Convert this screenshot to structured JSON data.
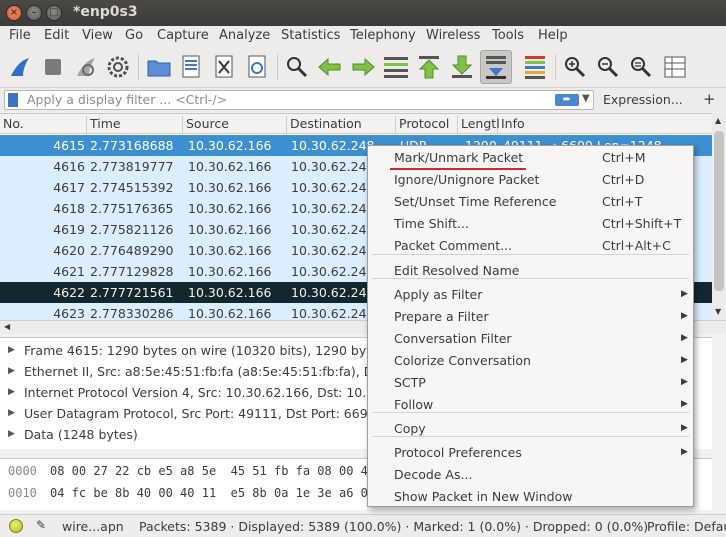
{
  "window": {
    "title": "*enp0s3"
  },
  "menubar": [
    "File",
    "Edit",
    "View",
    "Go",
    "Capture",
    "Analyze",
    "Statistics",
    "Telephony",
    "Wireless",
    "Tools",
    "Help"
  ],
  "toolbar_icons": [
    "shark-fin-start-icon",
    "stop-icon",
    "restart-icon",
    "options-gear-icon",
    "open-folder-icon",
    "save-file-icon",
    "close-file-icon",
    "reload-icon",
    "find-magnifier-icon",
    "go-back-icon",
    "go-forward-icon",
    "go-to-packet-icon",
    "first-packet-icon",
    "last-packet-icon",
    "autoscroll-icon",
    "colorize-icon",
    "zoom-in-icon",
    "zoom-out-icon",
    "zoom-normal-icon",
    "resize-columns-icon"
  ],
  "filter": {
    "placeholder": "Apply a display filter ... <Ctrl-/>",
    "expression_label": "Expression...",
    "plus": "+"
  },
  "columns": [
    "No.",
    "Time",
    "Source",
    "Destination",
    "Protocol",
    "Lengtl",
    "Info"
  ],
  "packets": [
    {
      "no": "4615",
      "time": "2.773168688",
      "src": "10.30.62.166",
      "dst": "10.30.62.248",
      "proto": "UDP",
      "len": "1290",
      "info": "49111 → 6699 Len=1248",
      "style": "sel"
    },
    {
      "no": "4616",
      "time": "2.773819777",
      "src": "10.30.62.166",
      "dst": "10.30.62.248",
      "style": "udp"
    },
    {
      "no": "4617",
      "time": "2.774515392",
      "src": "10.30.62.166",
      "dst": "10.30.62.248",
      "style": "udp"
    },
    {
      "no": "4618",
      "time": "2.775176365",
      "src": "10.30.62.166",
      "dst": "10.30.62.248",
      "style": "udp"
    },
    {
      "no": "4619",
      "time": "2.775821126",
      "src": "10.30.62.166",
      "dst": "10.30.62.248",
      "style": "udp"
    },
    {
      "no": "4620",
      "time": "2.776489290",
      "src": "10.30.62.166",
      "dst": "10.30.62.248",
      "style": "udp"
    },
    {
      "no": "4621",
      "time": "2.777129828",
      "src": "10.30.62.166",
      "dst": "10.30.62.248",
      "style": "udp"
    },
    {
      "no": "4622",
      "time": "2.777721561",
      "src": "10.30.62.166",
      "dst": "10.30.62.248",
      "style": "dark"
    },
    {
      "no": "4623",
      "time": "2.778330286",
      "src": "10.30.62.166",
      "dst": "10.30.62.248",
      "style": "udp"
    }
  ],
  "details": [
    "Frame 4615: 1290 bytes on wire (10320 bits), 1290 byte",
    "Ethernet II, Src: a8:5e:45:51:fb:fa (a8:5e:45:51:fb:fa), Dst",
    "Internet Protocol Version 4, Src: 10.30.62.166, Dst: 10.3",
    "User Datagram Protocol, Src Port: 49111, Dst Port: 6699",
    "Data (1248 bytes)"
  ],
  "bytes": [
    {
      "offset": "0000",
      "hex": "08 00 27 22 cb e5 a8 5e  45 51 fb fa 08 00 45"
    },
    {
      "offset": "0010",
      "hex": "04 fc be 8b 40 00 40 11  e5 8b 0a 1e 3e a6 0a"
    }
  ],
  "status": {
    "file": "wire...apn",
    "packets": "Packets: 5389 · Displayed: 5389 (100.0%) · Marked: 1 (0.0%) · Dropped: 0 (0.0%)",
    "profile": "Profile: Defau"
  },
  "context_menu": [
    {
      "label": "Mark/Unmark Packet",
      "shortcut": "Ctrl+M"
    },
    {
      "label": "Ignore/Unignore Packet",
      "shortcut": "Ctrl+D"
    },
    {
      "label": "Set/Unset Time Reference",
      "shortcut": "Ctrl+T"
    },
    {
      "label": "Time Shift...",
      "shortcut": "Ctrl+Shift+T"
    },
    {
      "label": "Packet Comment...",
      "shortcut": "Ctrl+Alt+C"
    },
    {
      "label": "Edit Resolved Name"
    },
    {
      "label": "Apply as Filter",
      "submenu": true
    },
    {
      "label": "Prepare a Filter",
      "submenu": true
    },
    {
      "label": "Conversation Filter",
      "submenu": true
    },
    {
      "label": "Colorize Conversation",
      "submenu": true
    },
    {
      "label": "SCTP",
      "submenu": true
    },
    {
      "label": "Follow",
      "submenu": true
    },
    {
      "label": "Copy",
      "submenu": true
    },
    {
      "label": "Protocol Preferences",
      "submenu": true
    },
    {
      "label": "Decode As..."
    },
    {
      "label": "Show Packet in New Window"
    }
  ],
  "colors": {
    "selected_row": "#3c8fd0",
    "udp_row": "#daeeff",
    "dark_row": "#12272e",
    "annotation_underline": "#d8242c"
  }
}
